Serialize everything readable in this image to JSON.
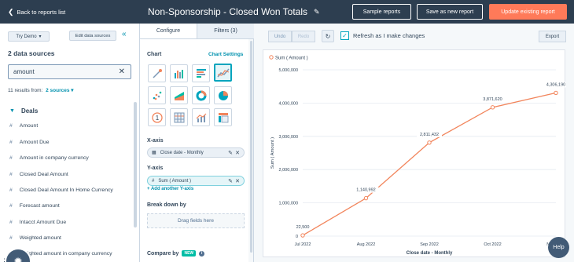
{
  "topbar": {
    "back_label": "Back to reports list",
    "title": "Non-Sponsorship - Closed Won Totals",
    "sample_label": "Sample reports",
    "save_as_label": "Save as new report",
    "update_label": "Update existing report"
  },
  "left": {
    "try_demo_label": "Try Demo",
    "edit_sources_label": "Edit data sources",
    "sources_title": "2 data sources",
    "search_value": "amount",
    "results_prefix": "11 results from:",
    "results_sources": "2 sources",
    "group_label": "Deals",
    "fields": [
      "Amount",
      "Amount Due",
      "Amount in company currency",
      "Closed Deal Amount",
      "Closed Deal Amount In Home Currency",
      "Forecast amount",
      "Intacct Amount Due",
      "Weighted amount",
      "Weighted amount in company currency"
    ]
  },
  "config": {
    "tab_configure": "Configure",
    "tab_filters": "Filters (3)",
    "chart_label": "Chart",
    "chart_settings_label": "Chart Settings",
    "xaxis_label": "X-axis",
    "xaxis_value": "Close date - Monthly",
    "yaxis_label": "Y-axis",
    "yaxis_value": "Sum ( Amount )",
    "add_y_label": "+ Add another Y-axis",
    "breakdown_label": "Break down by",
    "drag_label": "Drag fields here",
    "compare_label": "Compare by",
    "new_badge": "NEW"
  },
  "toolbar": {
    "undo_label": "Undo",
    "redo_label": "Redo",
    "refresh_label": "Refresh as I make changes",
    "export_label": "Export"
  },
  "help_label": "Help",
  "colors": {
    "accent": "#ff7a59",
    "line": "#f2855c",
    "teal": "#00a4bd",
    "dark": "#2d3e50"
  },
  "chart_data": {
    "type": "line",
    "title": "",
    "legend": [
      "Sum ( Amount )"
    ],
    "legend_position": "top-left",
    "xlabel": "Close date - Monthly",
    "ylabel": "Sum ( Amount )",
    "categories": [
      "Jul 2022",
      "Aug 2022",
      "Sep 2022",
      "Oct 2022",
      "Nov 2022"
    ],
    "series": [
      {
        "name": "Sum ( Amount )",
        "values": [
          22500,
          1140992,
          2811432,
          3871620,
          4306190
        ]
      }
    ],
    "data_labels": [
      "22,500",
      "1,140,992",
      "2,811,432",
      "3,871,620",
      "4,306,190"
    ],
    "yticks": [
      "0",
      "1,000,000",
      "2,000,000",
      "3,000,000",
      "4,000,000",
      "5,000,000"
    ],
    "ylim": [
      0,
      5000000
    ],
    "grid": true
  }
}
